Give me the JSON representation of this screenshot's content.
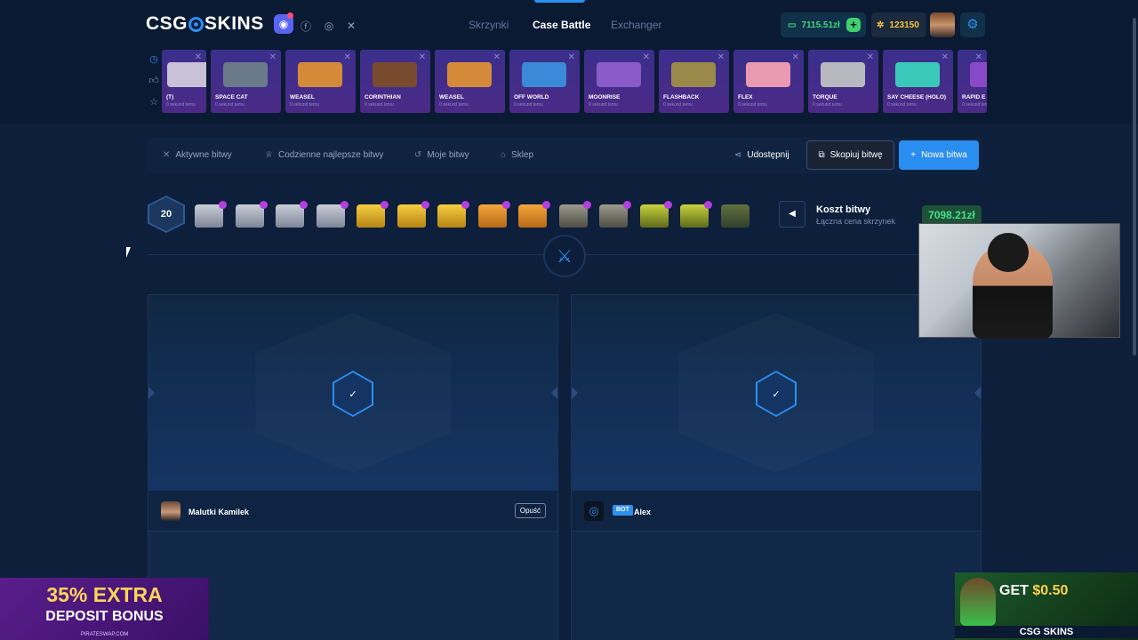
{
  "header": {
    "logo_left": "CSG",
    "logo_right": "SKINS",
    "nav": [
      {
        "label": "Skrzynki",
        "active": false
      },
      {
        "label": "Case Battle",
        "active": true
      },
      {
        "label": "Exchanger",
        "active": false
      }
    ],
    "balance": "7115.51zł",
    "coins": "123150"
  },
  "live_drops": [
    {
      "name": "(T)",
      "sub": "0 sekund temu",
      "color": "#c9c1d8"
    },
    {
      "name": "SPACE CAT",
      "sub": "0 sekund temu",
      "color": "#6a7a8a"
    },
    {
      "name": "WEASEL",
      "sub": "0 sekund temu",
      "color": "#d58a3a"
    },
    {
      "name": "CORINTHIAN",
      "sub": "0 sekund temu",
      "color": "#7a4a2e"
    },
    {
      "name": "WEASEL",
      "sub": "0 sekund temu",
      "color": "#d58a3a"
    },
    {
      "name": "OFF WORLD",
      "sub": "0 sekund temu",
      "color": "#3a8ad8"
    },
    {
      "name": "MOONRISE",
      "sub": "0 sekund temu",
      "color": "#8a5ac8"
    },
    {
      "name": "FLASHBACK",
      "sub": "0 sekund temu",
      "color": "#9a8a4a"
    },
    {
      "name": "FLEX",
      "sub": "0 sekund temu",
      "color": "#e89ab0"
    },
    {
      "name": "TORQUE",
      "sub": "0 sekund temu",
      "color": "#b8b8c0"
    },
    {
      "name": "SAY CHEESE (HOLO)",
      "sub": "0 sekund temu",
      "color": "#3ac8b8"
    },
    {
      "name": "RAPID E MOVEMI",
      "sub": "0 sekund temu",
      "color": "#8a4ac8"
    }
  ],
  "tabs": [
    {
      "label": "Aktywne bitwy",
      "icon": "swords-icon"
    },
    {
      "label": "Codzienne najlepsze bitwy",
      "icon": "trophy-icon"
    },
    {
      "label": "Moje bitwy",
      "icon": "history-icon"
    },
    {
      "label": "Sklep",
      "icon": "basket-icon"
    }
  ],
  "actions": {
    "share": "Udostępnij",
    "copy": "Skopiuj bitwę",
    "new": "Nowa bitwa"
  },
  "battle": {
    "rounds": "20",
    "cases": [
      "silver",
      "silver",
      "silver",
      "silver",
      "gold",
      "gold",
      "gold",
      "orange",
      "orange",
      "spiky",
      "spiky",
      "green",
      "green",
      "faded"
    ],
    "cost_title": "Koszt bitwy",
    "cost_sub": "Łączna cena skrzynek",
    "cost_value": "7098.21zł"
  },
  "players": [
    {
      "name": "Malutki Kamilek",
      "leave": "Opuść",
      "bot": false
    },
    {
      "name": "Alex",
      "bot_tag": "BOT",
      "bot": true
    }
  ],
  "ads": {
    "left_line1": "35% EXTRA",
    "left_line2": "DEPOSIT BONUS",
    "left_site": "PIRATESWAP.COM",
    "right_get": "GET",
    "right_amount": "$0.50",
    "right_brand": "CSG SKINS"
  }
}
